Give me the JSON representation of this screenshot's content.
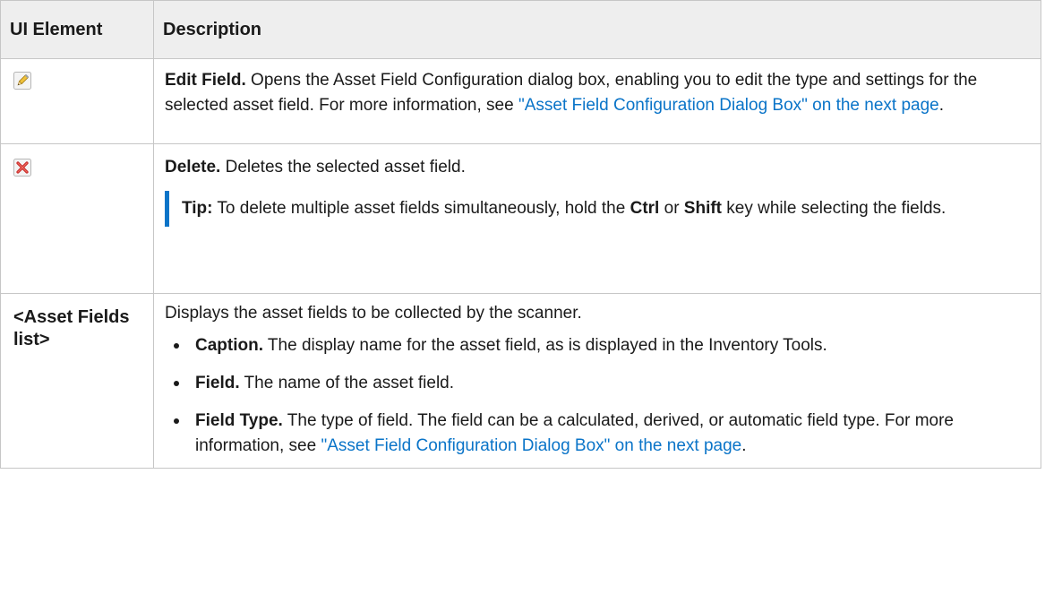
{
  "table": {
    "headers": {
      "col1": "UI Element",
      "col2": "Description"
    },
    "rows": [
      {
        "icon": "edit-pencil-icon",
        "title": "Edit Field.",
        "text": " Opens the Asset Field Configuration dialog box, enabling you to edit the type and settings for the selected asset field. For more information, see ",
        "link": "\"Asset Field Configuration Dialog Box\" on the next page",
        "after": "."
      },
      {
        "icon": "delete-x-icon",
        "title": "Delete.",
        "text": " Deletes the selected asset field.",
        "tip": {
          "label": "Tip:",
          "text1": "  To delete multiple asset fields simultaneously, hold the ",
          "key1": "Ctrl",
          "text2": " or ",
          "key2": "Shift",
          "text3": " key while selecting the fields."
        }
      },
      {
        "element": "<Asset Fields list>",
        "intro": "Displays the asset fields to be collected by the scanner.",
        "items": [
          {
            "label": "Caption.",
            "text": " The display name for the asset field, as is displayed in the Inventory Tools."
          },
          {
            "label": "Field.",
            "text": " The name of the asset field."
          },
          {
            "label": "Field Type.",
            "text": " The type of field. The field can be a calculated, derived, or automatic field type. For more information, see ",
            "link": "\"Asset Field Configuration Dialog Box\" on the next page",
            "after": "."
          }
        ]
      }
    ]
  },
  "colors": {
    "link": "#0a74c8",
    "header_bg": "#eeeeee",
    "border": "#c6c6c6"
  }
}
